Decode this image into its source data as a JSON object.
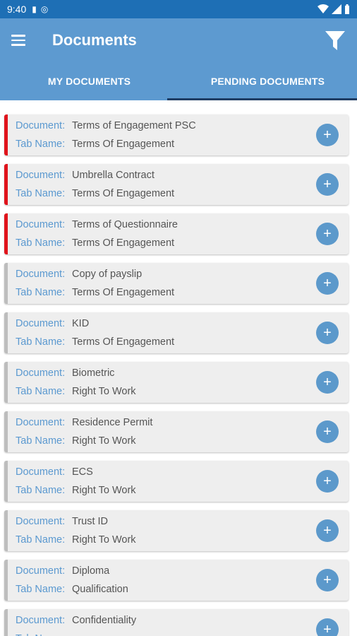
{
  "status_bar": {
    "time": "9:40"
  },
  "app_bar": {
    "title": "Documents"
  },
  "tabs": [
    {
      "label": "MY DOCUMENTS"
    },
    {
      "label": "PENDING DOCUMENTS"
    }
  ],
  "labels": {
    "document": "Document:",
    "tab_name": "Tab Name:"
  },
  "add_symbol": "+",
  "documents": [
    {
      "document": "Terms of Engagement PSC",
      "tab_name": "Terms Of Engagement",
      "urgent": true
    },
    {
      "document": "Umbrella Contract",
      "tab_name": "Terms Of Engagement",
      "urgent": true
    },
    {
      "document": "Terms of Questionnaire",
      "tab_name": "Terms Of Engagement",
      "urgent": true
    },
    {
      "document": "Copy of payslip",
      "tab_name": "Terms Of Engagement",
      "urgent": false
    },
    {
      "document": "KID",
      "tab_name": "Terms Of Engagement",
      "urgent": false
    },
    {
      "document": "Biometric",
      "tab_name": "Right To Work",
      "urgent": false
    },
    {
      "document": "Residence Permit",
      "tab_name": "Right To Work",
      "urgent": false
    },
    {
      "document": "ECS",
      "tab_name": "Right To Work",
      "urgent": false
    },
    {
      "document": "Trust ID",
      "tab_name": "Right To Work",
      "urgent": false
    },
    {
      "document": "Diploma",
      "tab_name": "Qualification",
      "urgent": false
    },
    {
      "document": "Confidentiality",
      "tab_name": "",
      "urgent": false
    }
  ],
  "colors": {
    "status_bar": "#1e6fb5",
    "app_bar": "#5d9ad0",
    "urgent": "#e0141c",
    "normal": "#bdbdbd",
    "label": "#5b99d0"
  }
}
